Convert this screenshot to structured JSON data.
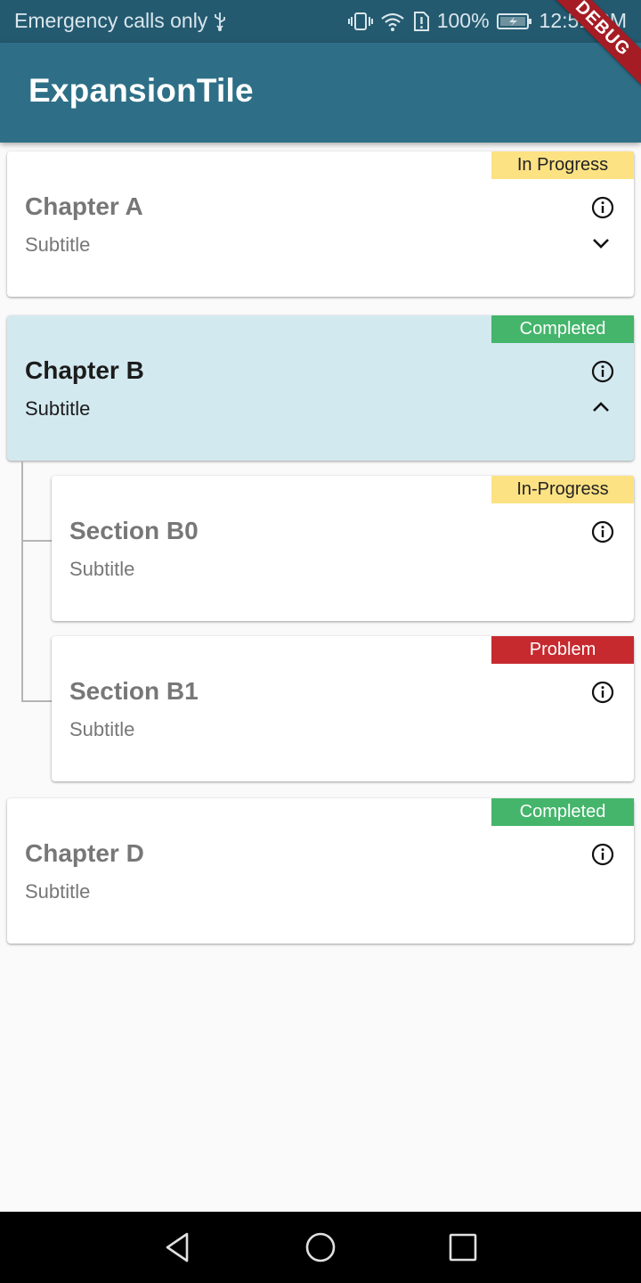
{
  "status_bar": {
    "carrier": "Emergency calls only",
    "battery": "100%",
    "time": "12:51 PM",
    "icons": [
      "usb-icon",
      "vibrate-icon",
      "wifi-icon",
      "sim-alert-icon",
      "battery-charging-icon"
    ]
  },
  "app_bar": {
    "title": "ExpansionTile",
    "debug_label": "DEBUG"
  },
  "items": [
    {
      "title": "Chapter A",
      "subtitle": "Subtitle",
      "status": "In Progress",
      "status_color": "#fde283",
      "expanded": false
    },
    {
      "title": "Chapter B",
      "subtitle": "Subtitle",
      "status": "Completed",
      "status_color": "#44b56b",
      "expanded": true,
      "children": [
        {
          "title": "Section B0",
          "subtitle": "Subtitle",
          "status": "In-Progress",
          "status_color": "#fde283"
        },
        {
          "title": "Section B1",
          "subtitle": "Subtitle",
          "status": "Problem",
          "status_color": "#c62a2f"
        }
      ]
    },
    {
      "title": "Chapter D",
      "subtitle": "Subtitle",
      "status": "Completed",
      "status_color": "#44b56b"
    }
  ],
  "colors": {
    "app_bar": "#2e6f87",
    "status_bar": "#245a70",
    "expanded_card": "#d3e9f0"
  },
  "nav_bar": {
    "icons": [
      "back-icon",
      "home-icon",
      "recents-icon"
    ]
  }
}
